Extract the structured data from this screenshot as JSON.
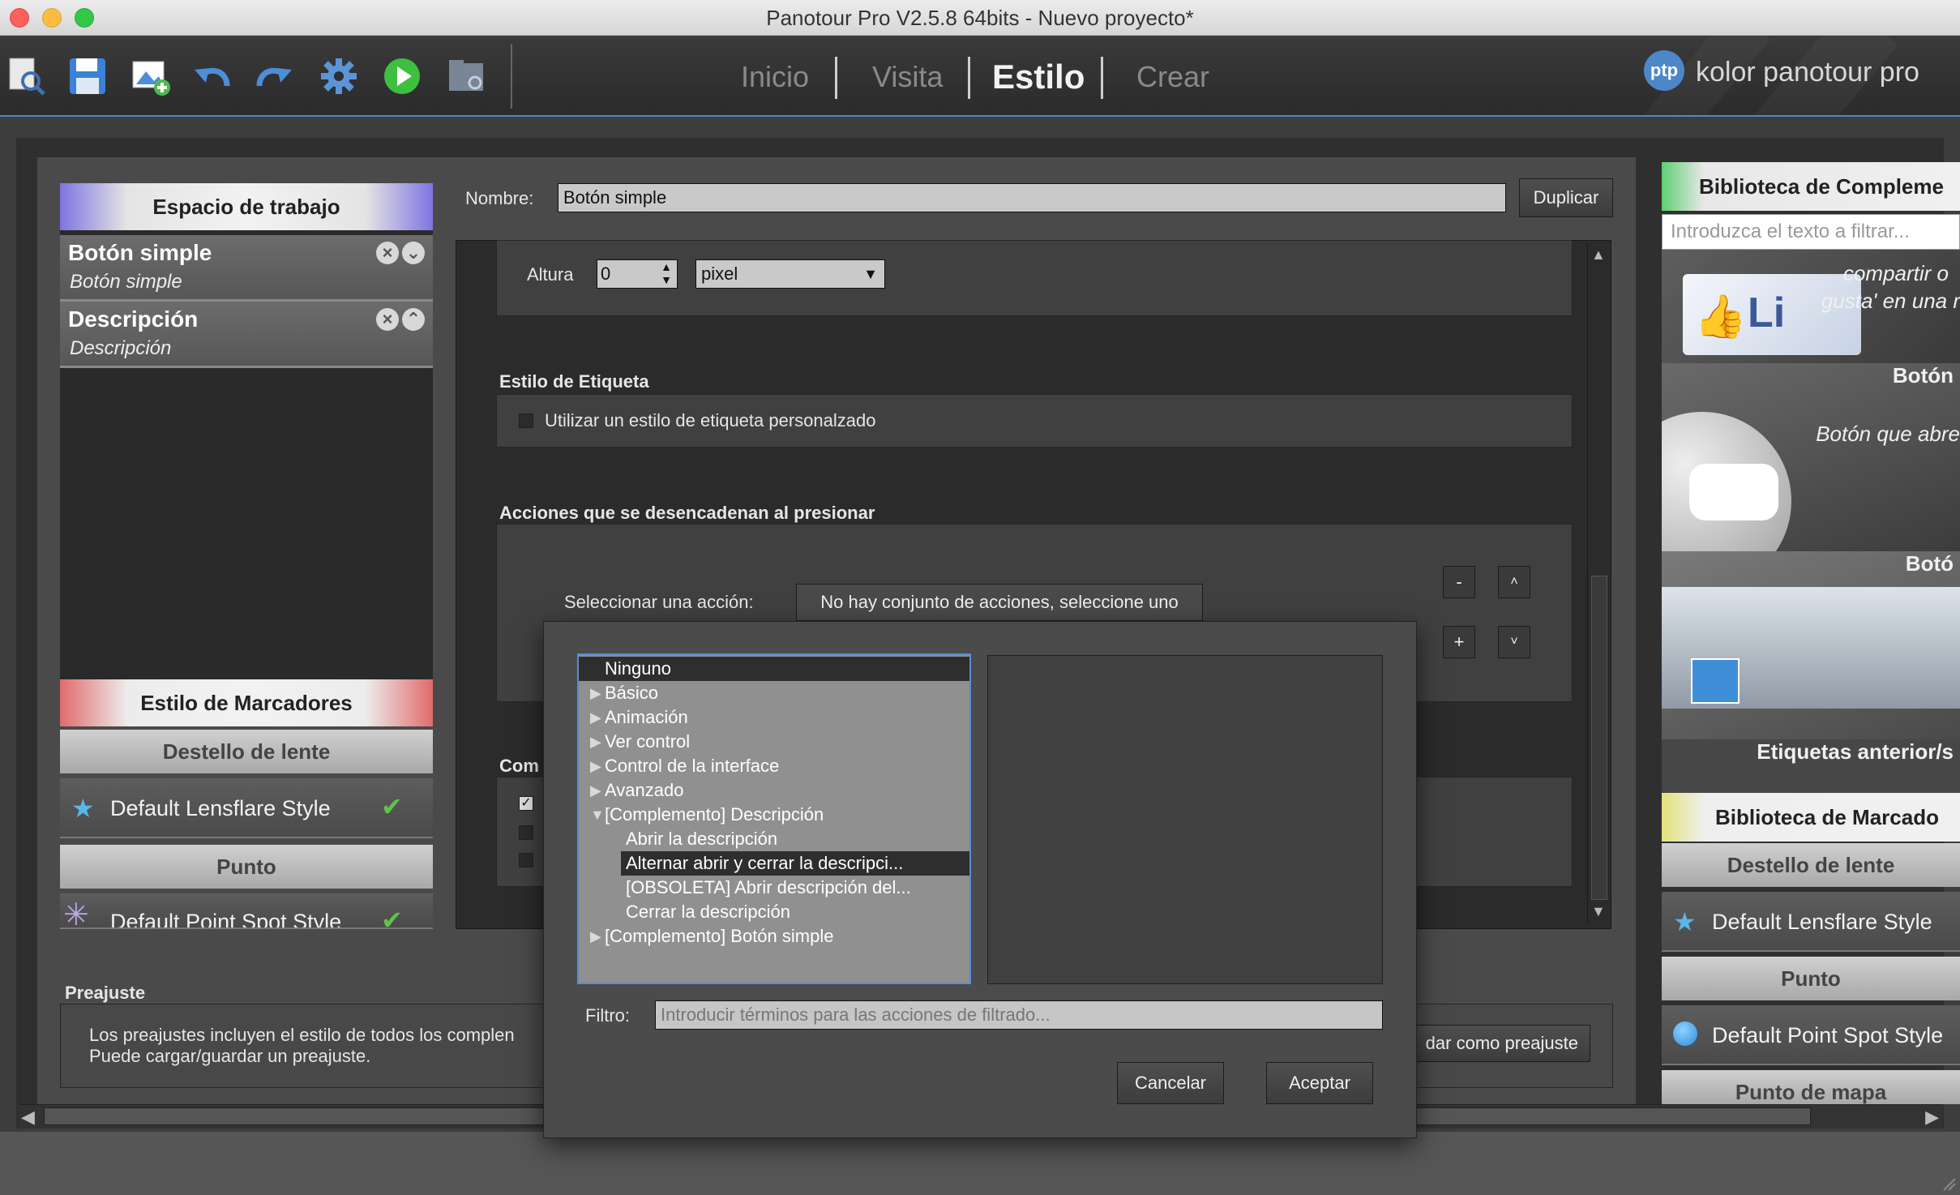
{
  "window": {
    "title": "Panotour Pro V2.5.8 64bits - Nuevo proyecto*"
  },
  "toolbar": {
    "icons": [
      "search-document-icon",
      "save-icon",
      "add-image-icon",
      "undo-icon",
      "redo-icon",
      "settings-gear-icon",
      "play-icon",
      "folder-search-icon"
    ],
    "tabs": [
      "Inicio",
      "Visita",
      "Estilo",
      "Crear"
    ],
    "active_tab": "Estilo",
    "brand_logo": "ptp",
    "brand_name": "kolor panotour pro"
  },
  "left_panel": {
    "workspace_header": "Espacio de trabajo",
    "workspace_items": [
      {
        "name": "Botón simple",
        "sub": "Botón simple"
      },
      {
        "name": "Descripción",
        "sub": "Descripción"
      }
    ],
    "markers_header": "Estilo de Marcadores",
    "lensflare_header": "Destello de lente",
    "lensflare_item": "Default Lensflare Style",
    "point_header": "Punto",
    "point_item": "Default Point Spot Style"
  },
  "form": {
    "name_label": "Nombre:",
    "name_value": "Botón simple",
    "duplicate_button": "Duplicar",
    "height_label": "Altura",
    "height_value": "0",
    "unit_value": "pixel",
    "label_style_title": "Estilo de Etiqueta",
    "label_style_checkbox": "Utilizar un estilo de etiqueta personalzado",
    "actions_title": "Acciones que se desencadenan al presionar",
    "select_action_label": "Seleccionar una acción:",
    "select_action_button": "No hay conjunto de acciones, seleccione uno",
    "minus": "-",
    "plus": "+",
    "up": "˄",
    "down": "˅",
    "partial_section_title": "Com"
  },
  "preset": {
    "title": "Preajuste",
    "text_line1": "Los preajustes incluyen el estilo de todos los complen",
    "text_line2": "Puede cargar/guardar un preajuste.",
    "save_button_partial": "dar como preajuste"
  },
  "right_panel": {
    "plugins_header": "Biblioteca de Compleme",
    "filter_placeholder": "Introduzca el texto a filtrar...",
    "tile1_caption_line1": "compartir o",
    "tile1_caption_line2": "gusta' en una r",
    "tile1_thumb_text": "Li",
    "tile2_title": "Botón",
    "tile2_caption": "Botón que abre",
    "tile3_title": "Botó",
    "tile4_title": "Etiquetas anterior/s",
    "markers_header": "Biblioteca de Marcado",
    "lensflare_header": "Destello de lente",
    "lensflare_item": "Default Lensflare Style",
    "point_header": "Punto",
    "point_item": "Default Point Spot Style",
    "map_point_header": "Punto de mapa"
  },
  "dialog": {
    "tree": [
      {
        "label": "Ninguno",
        "level": 0,
        "arrow": "",
        "selected": true
      },
      {
        "label": "Básico",
        "level": 0,
        "arrow": "▶"
      },
      {
        "label": "Animación",
        "level": 0,
        "arrow": "▶"
      },
      {
        "label": "Ver control",
        "level": 0,
        "arrow": "▶"
      },
      {
        "label": "Control de la interface",
        "level": 0,
        "arrow": "▶"
      },
      {
        "label": "Avanzado",
        "level": 0,
        "arrow": "▶"
      },
      {
        "label": "[Complemento] Descripción",
        "level": 0,
        "arrow": "▼"
      },
      {
        "label": "Abrir la descripción",
        "level": 1,
        "arrow": ""
      },
      {
        "label": "Alternar abrir y cerrar la descripci...",
        "level": 1,
        "arrow": "",
        "highlighted": true
      },
      {
        "label": "[OBSOLETA] Abrir descripción del...",
        "level": 1,
        "arrow": ""
      },
      {
        "label": "Cerrar la descripción",
        "level": 1,
        "arrow": ""
      },
      {
        "label": "[Complemento] Botón simple",
        "level": 0,
        "arrow": "▶"
      }
    ],
    "filter_label": "Filtro:",
    "filter_placeholder": "Introducir términos para las acciones de filtrado...",
    "cancel_button": "Cancelar",
    "accept_button": "Aceptar"
  },
  "colors": {
    "accent_blue": "#4f87c2",
    "selection_dark": "#2e2e2e",
    "check_green": "#5ec44a"
  }
}
